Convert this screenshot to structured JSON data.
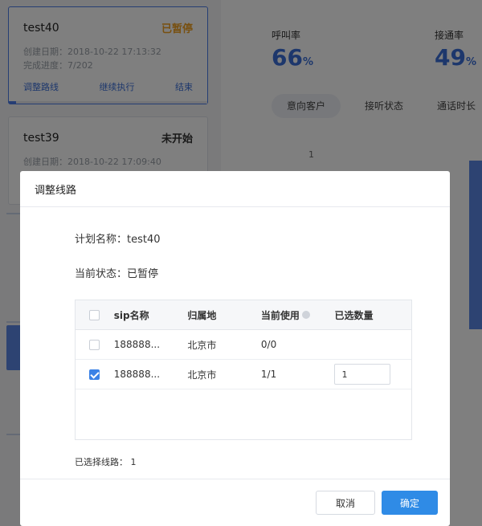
{
  "tasks": [
    {
      "name": "test40",
      "status": "已暂停",
      "status_color": "#f0a020",
      "created": "创建日期：2018-10-22 17:13:32",
      "progress_text": "完成进度：7/202",
      "progress_fraction": 0.035,
      "actions": [
        "调整路线",
        "继续执行",
        "结束"
      ]
    },
    {
      "name": "test39",
      "status": "未开始",
      "status_color": "#333333",
      "created": "创建日期：2018-10-22 17:09:40"
    }
  ],
  "stats": {
    "call_rate_label": "呼叫率",
    "call_rate_value": "66",
    "connect_rate_label": "接通率",
    "connect_rate_value": "49",
    "percent": "%"
  },
  "tabs": [
    "意向客户",
    "接听状态",
    "通话时长"
  ],
  "axis_tick": "1",
  "dialog": {
    "title": "调整线路",
    "plan_name": "计划名称：test40",
    "current_status": "当前状态：已暂停",
    "table": {
      "headers": [
        "sip名称",
        "归属地",
        "当前使用",
        "已选数量"
      ],
      "rows": [
        {
          "sip": "188888...",
          "location": "北京市",
          "usage": "0/0",
          "checked": false,
          "qty": ""
        },
        {
          "sip": "188888...",
          "location": "北京市",
          "usage": "1/1",
          "checked": true,
          "qty": "1"
        }
      ]
    },
    "selected_lines": "已选择线路： 1",
    "cancel_label": "取消",
    "ok_label": "确定"
  }
}
